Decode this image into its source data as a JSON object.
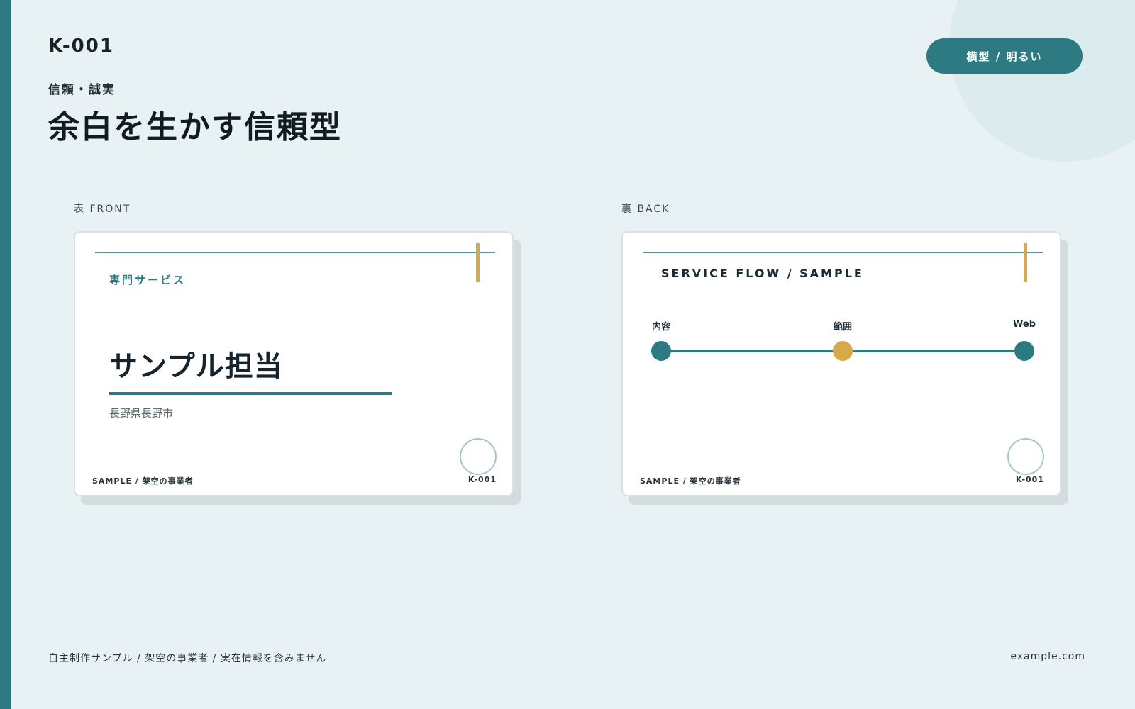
{
  "header": {
    "code": "K-001",
    "category": "信頼・誠実",
    "title": "余白を生かす信頼型",
    "style_badge": "横型 / 明るい"
  },
  "front": {
    "side_label": "表 FRONT",
    "service_label": "専門サービス",
    "name": "サンプル担当",
    "location": "長野県長野市",
    "footer_left": "SAMPLE / 架空の事業者",
    "footer_right": "K-001"
  },
  "back": {
    "side_label": "裏 BACK",
    "flow_title": "SERVICE FLOW / SAMPLE",
    "flow_steps": [
      {
        "label": "内容",
        "color": "#2e7a82"
      },
      {
        "label": "範囲",
        "color": "#d7a94a"
      },
      {
        "label": "Web",
        "color": "#2e7a82"
      }
    ],
    "footer_left": "SAMPLE / 架空の事業者",
    "footer_right": "K-001"
  },
  "footer": {
    "note": "自主制作サンプル / 架空の事業者 / 実在情報を含みません",
    "domain": "example.com"
  },
  "colors": {
    "accent": "#2e7a82",
    "gold": "#d7a94a",
    "background": "#e8f1f3"
  }
}
